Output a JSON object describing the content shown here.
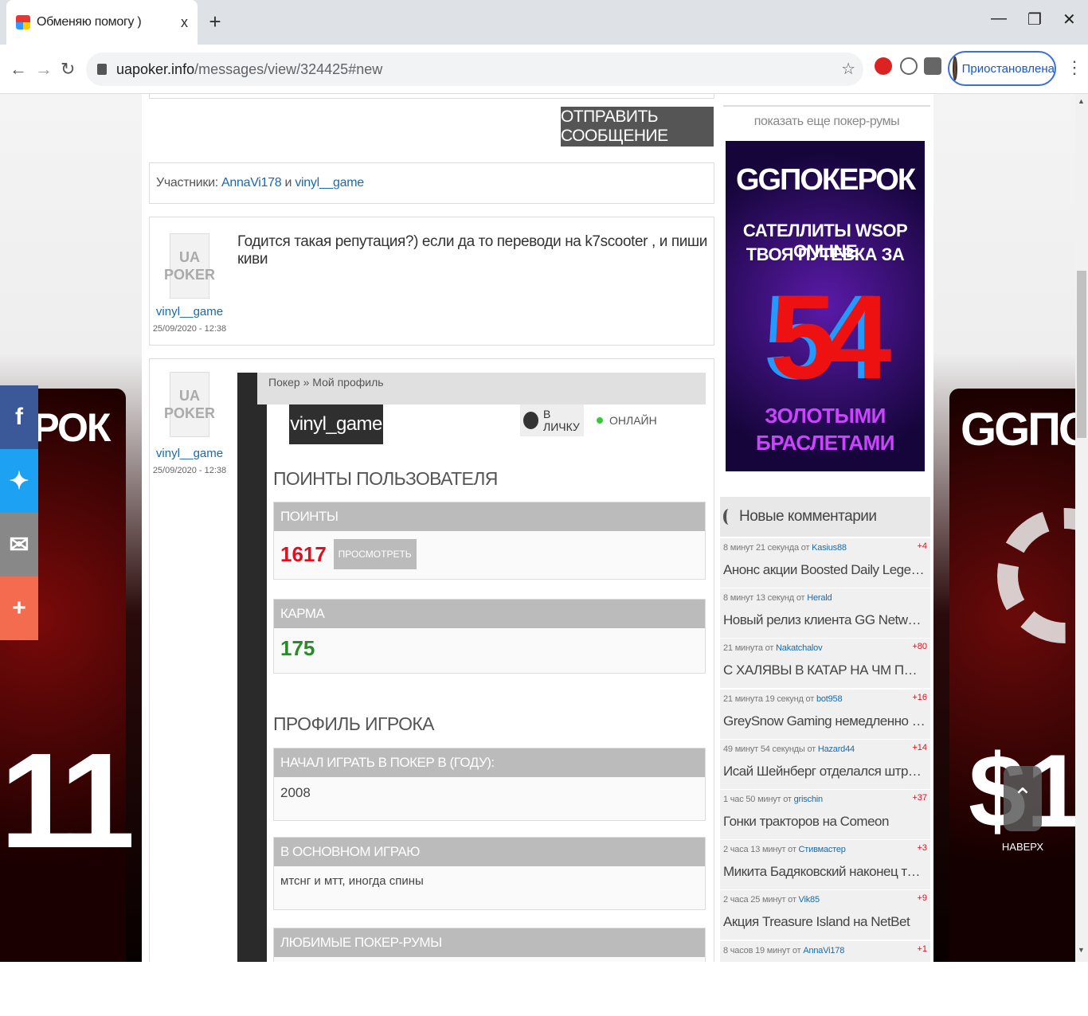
{
  "browser": {
    "tab_title": "Обменяю помогу )",
    "tab_close": "x",
    "new_tab": "+",
    "url_host": "uapoker.info",
    "url_path": "/messages/view/324425#new",
    "profile_label": "Приостановлена"
  },
  "thread": {
    "send_button": "ОТПРАВИТЬ СООБЩЕНИЕ",
    "participants_label": "Участники:",
    "participant_1": "AnnaVi178",
    "participants_and": "и",
    "participant_2": "vinyl__game"
  },
  "messages": [
    {
      "avatar_top": "UA",
      "avatar_bottom": "POKER",
      "author": "vinyl__game",
      "date": "25/09/2020 - 12:38",
      "text": "Годится такая репутация?) если да то переводи на k7scooter , и пиши киви"
    },
    {
      "avatar_top": "UA",
      "avatar_bottom": "POKER",
      "author": "vinyl__game",
      "date": "25/09/2020 - 12:38"
    }
  ],
  "profile_embed": {
    "breadcrumb": "Покер » Мой профиль",
    "username": "vinyl_game",
    "pm_label": "В ЛИЧКУ",
    "online_label": "ОНЛАЙН",
    "points_section": "ПОИНТЫ ПОЛЬЗОВАТЕЛЯ",
    "points_header": "ПОИНТЫ",
    "points_value": "1617",
    "view_button": "ПРОСМОТРЕТЬ",
    "karma_header": "КАРМА",
    "karma_value": "175",
    "player_section": "ПРОФИЛЬ ИГРОКА",
    "started_header": "НАЧАЛ ИГРАТЬ В ПОКЕР В (ГОДУ):",
    "started_value": "2008",
    "mainly_header": "В ОСНОВНОМ ИГРАЮ",
    "mainly_value": "мтснг и мтт, иногда спины",
    "rooms_header": "ЛЮБИМЫЕ ПОКЕР-РУМЫ"
  },
  "sidebar": {
    "more_rooms": "показать еще покер-румы",
    "ad": {
      "logo": "GGПОКЕРОК",
      "line1": "САТЕЛЛИТЫ WSOP ONLINE",
      "line2": "ТВОЯ ПУТЕВКА ЗА",
      "number": "54",
      "line3": "ЗОЛОТЫМИ",
      "line4": "БРАСЛЕТАМИ"
    },
    "comments_title": "Новые комментарии",
    "comments": [
      {
        "time": "8 минут 21 секунда от",
        "user": "Kasius88",
        "score": "+4",
        "text": "Анонс акции Boosted Daily Legends на party..."
      },
      {
        "time": "8 минут 13 секунд от",
        "user": "Herald",
        "score": "",
        "text": "Новый релиз клиента GG Network: наноста..."
      },
      {
        "time": "21 минута от",
        "user": "Nakatchalov",
        "score": "+80",
        "text": "С ХАЛЯВЫ В КАТАР НА ЧМ ПО ФУТБОЛУ ..."
      },
      {
        "time": "21 минута 19 секунд от",
        "user": "bot958",
        "score": "+16",
        "text": "GreySnow Gaming немедленно прекращае..."
      },
      {
        "time": "49 минут 54 секунды от",
        "user": "Hazard44",
        "score": "+14",
        "text": "Исай Шейнберг отделался штрафом"
      },
      {
        "time": "1 час 50 минут от",
        "user": "grischin",
        "score": "+37",
        "text": "Гонки тракторов на Comeon"
      },
      {
        "time": "2 часа 13 минут от",
        "user": "Стивмастер",
        "score": "+3",
        "text": "Микита Бадяковский наконец то выиграл с..."
      },
      {
        "time": "2 часа 25 минут от",
        "user": "Vik85",
        "score": "+9",
        "text": "Акция Treasure Island на NetBet"
      },
      {
        "time": "8 часов 19 минут от",
        "user": "AnnaVi178",
        "score": "+1",
        "text": ""
      }
    ]
  },
  "bg": {
    "left_banner": "ЕРОК",
    "left_number": "11",
    "right_banner": "GGПО",
    "right_number": "$1"
  },
  "to_top_label": "НАВЕРХ",
  "share_icons": [
    "facebook-icon",
    "twitter-icon",
    "email-icon",
    "plus-icon"
  ]
}
